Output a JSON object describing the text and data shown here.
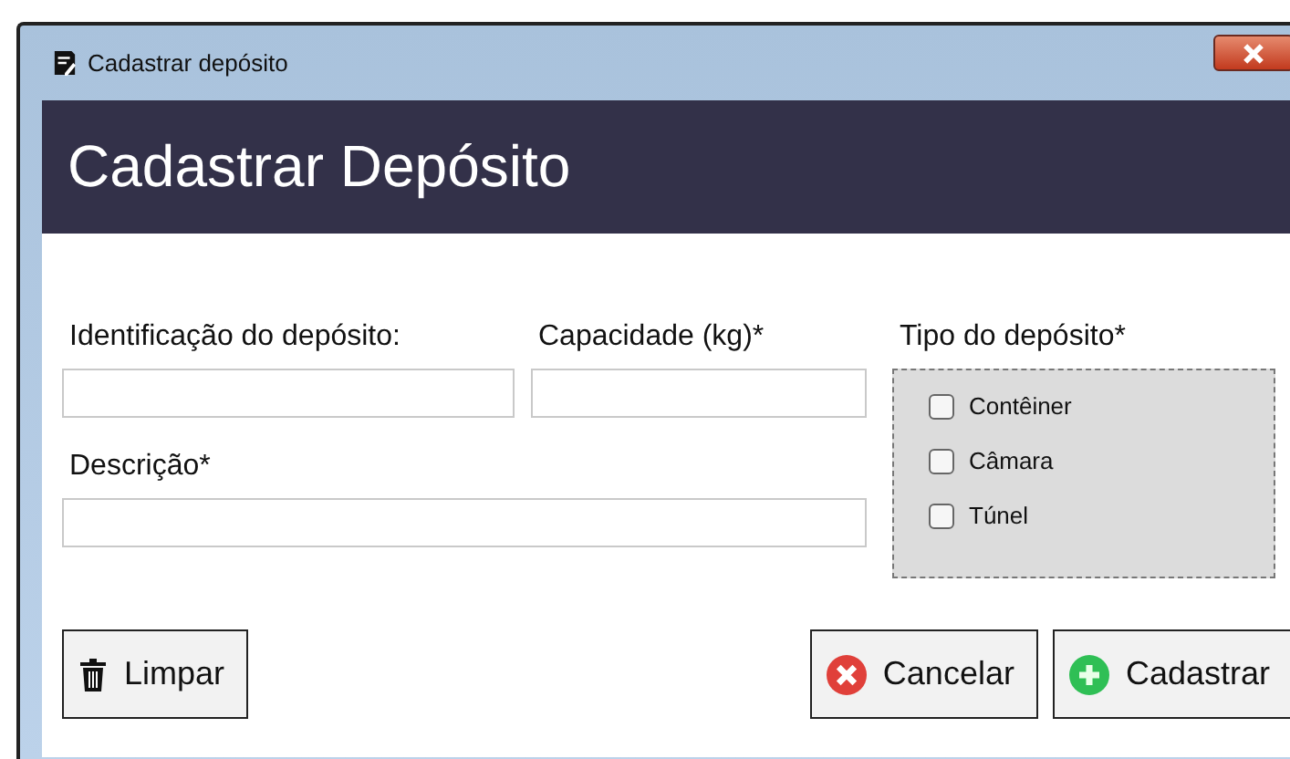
{
  "window": {
    "title": "Cadastrar depósito"
  },
  "header": {
    "title": "Cadastrar Depósito"
  },
  "fields": [
    {
      "label": "Identificação do depósito:"
    },
    {
      "label": "Capacidade (kg)*"
    }
  ],
  "description": {
    "label": "Descrição*"
  },
  "type_group": {
    "label": "Tipo do depósito*",
    "options": [
      {
        "label": "Contêiner",
        "checked": false
      },
      {
        "label": "Câmara",
        "checked": false
      },
      {
        "label": "Túnel",
        "checked": false
      }
    ]
  },
  "buttons": [
    {
      "label": "Limpar",
      "kind": "clear"
    },
    {
      "label": "Cancelar",
      "kind": "cancel"
    },
    {
      "label": "Cadastrar",
      "kind": "add"
    }
  ]
}
